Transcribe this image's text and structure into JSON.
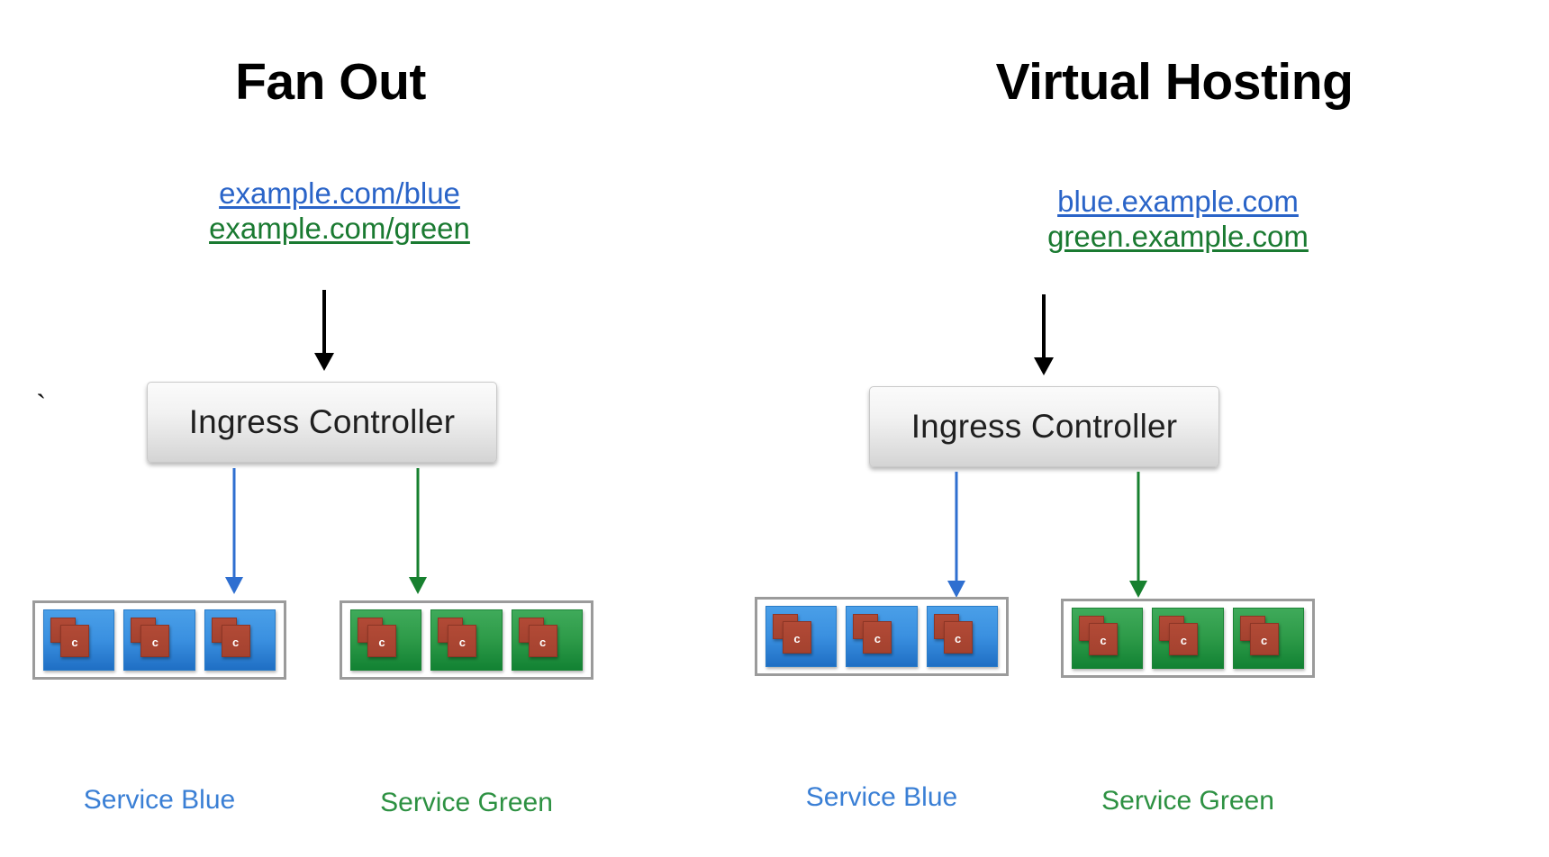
{
  "diagram": {
    "background_color": "#ffffff",
    "colors": {
      "blue_link": "#2a64c8",
      "green_link": "#1a7a31",
      "blue_service": "#3a90e0",
      "green_service": "#2e9b49",
      "container_red": "#a4422f",
      "arrow_black": "#000000",
      "arrow_blue": "#2f6fd0",
      "arrow_green": "#17802f",
      "box_border_grey": "#9b9b9b"
    },
    "stray_mark": "`"
  },
  "panels": [
    {
      "id": "fan-out",
      "title": "Fan Out",
      "urls": [
        {
          "text": "example.com/blue",
          "color": "blue"
        },
        {
          "text": "example.com/green",
          "color": "green"
        }
      ],
      "ingress": {
        "label": "Ingress Controller"
      },
      "services": [
        {
          "id": "service-blue",
          "label": "Service Blue",
          "color": "blue",
          "pods": [
            {
              "container_label": "c"
            },
            {
              "container_label": "c"
            },
            {
              "container_label": "c"
            }
          ]
        },
        {
          "id": "service-green",
          "label": "Service Green",
          "color": "green",
          "pods": [
            {
              "container_label": "c"
            },
            {
              "container_label": "c"
            },
            {
              "container_label": "c"
            }
          ]
        }
      ]
    },
    {
      "id": "virtual-hosting",
      "title": "Virtual Hosting",
      "urls": [
        {
          "text": "blue.example.com",
          "color": "blue"
        },
        {
          "text": "green.example.com",
          "color": "green"
        }
      ],
      "ingress": {
        "label": "Ingress Controller"
      },
      "services": [
        {
          "id": "service-blue",
          "label": "Service Blue",
          "color": "blue",
          "pods": [
            {
              "container_label": "c"
            },
            {
              "container_label": "c"
            },
            {
              "container_label": "c"
            }
          ]
        },
        {
          "id": "service-green",
          "label": "Service Green",
          "color": "green",
          "pods": [
            {
              "container_label": "c"
            },
            {
              "container_label": "c"
            },
            {
              "container_label": "c"
            }
          ]
        }
      ]
    }
  ]
}
